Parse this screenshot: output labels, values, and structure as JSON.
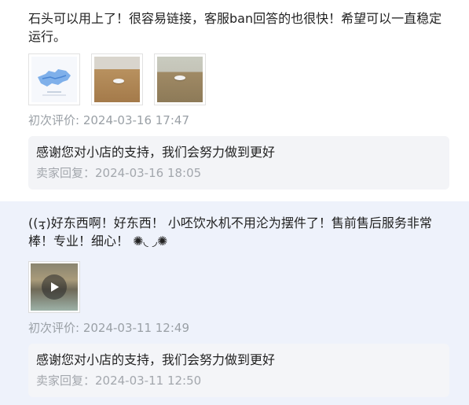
{
  "reviews": [
    {
      "text": "石头可以用上了！很容易链接，客服ban回答的也很快！希望可以一直稳定运行。",
      "time": "初次评价: 2024-03-16 17:47",
      "reply": {
        "text": "感谢您对小店的支持，我们会努力做到更好",
        "time": "卖家回复：2024-03-16 18:05"
      }
    },
    {
      "text": "((ᢋ)好东西啊！好东西！ 小呸饮水机不用沦为摆件了！售前售后服务非常棒！专业！细心！ ✺◟ ◞✺",
      "time": "初次评价: 2024-03-11 12:49",
      "reply": {
        "text": "感谢您对小店的支持，我们会努力做到更好",
        "time": "卖家回复：2024-03-11 12:50"
      }
    }
  ],
  "colors": {
    "highlight_bg": "#eef2fb",
    "reply_bg": "#f3f4f7",
    "muted_text": "#9aa0a6"
  }
}
